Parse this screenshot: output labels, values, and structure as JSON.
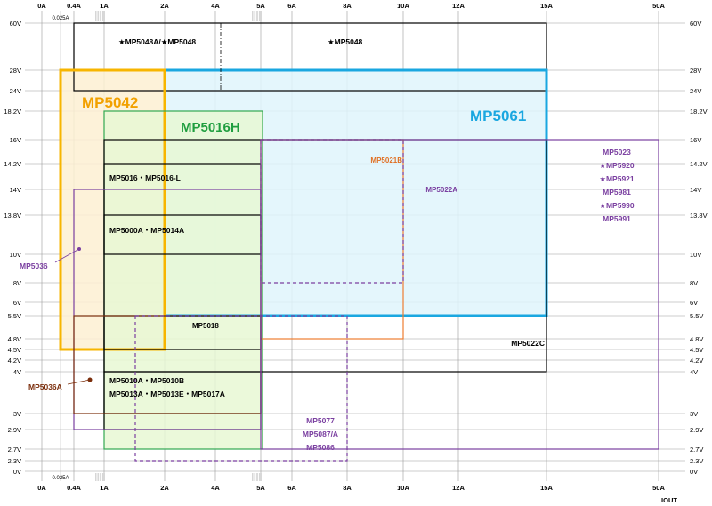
{
  "chart_data": {
    "type": "table",
    "x_axis": {
      "ticks": [
        {
          "label": "0A",
          "x": 0
        },
        {
          "label": "0.4A",
          "x": 0.4
        },
        {
          "label": "1A",
          "x": 1
        },
        {
          "label": "2A",
          "x": 2
        },
        {
          "label": "4A",
          "x": 4
        },
        {
          "label": "5A",
          "x": 5
        },
        {
          "label": "6A",
          "x": 6
        },
        {
          "label": "8A",
          "x": 8
        },
        {
          "label": "10A",
          "x": 10
        },
        {
          "label": "12A",
          "x": 12
        },
        {
          "label": "15A",
          "x": 15
        },
        {
          "label": "50A",
          "x": 50
        }
      ],
      "extra_tick": {
        "label": "0.025A",
        "x": 0.025
      },
      "unit_label": "IOUT"
    },
    "y_axis": {
      "ticks": [
        {
          "label": "0V",
          "y": 0
        },
        {
          "label": "2.3V",
          "y": 2.3
        },
        {
          "label": "2.7V",
          "y": 2.7
        },
        {
          "label": "2.9V",
          "y": 2.9
        },
        {
          "label": "3V",
          "y": 3
        },
        {
          "label": "4V",
          "y": 4
        },
        {
          "label": "4.2V",
          "y": 4.2
        },
        {
          "label": "4.5V",
          "y": 4.5
        },
        {
          "label": "4.8V",
          "y": 4.8
        },
        {
          "label": "5.5V",
          "y": 5.5
        },
        {
          "label": "6V",
          "y": 6
        },
        {
          "label": "8V",
          "y": 8
        },
        {
          "label": "10V",
          "y": 10
        },
        {
          "label": "13.8V",
          "y": 13.8
        },
        {
          "label": "14V",
          "y": 14
        },
        {
          "label": "14.2V",
          "y": 14.2
        },
        {
          "label": "16V",
          "y": 16
        },
        {
          "label": "18.2V",
          "y": 18.2
        },
        {
          "label": "24V",
          "y": 24
        },
        {
          "label": "28V",
          "y": 28
        },
        {
          "label": "60V",
          "y": 60
        }
      ]
    },
    "regions": [
      {
        "labels": [
          "★MP5048A/★MP5048",
          "★MP5048"
        ],
        "x": [
          0.4,
          15
        ],
        "y": [
          24,
          60
        ],
        "color": "#000000",
        "style": "solid"
      },
      {
        "labels": [
          "MP5061"
        ],
        "x": [
          2,
          15
        ],
        "y": [
          5.5,
          28
        ],
        "color": "#1aa7e0",
        "fill": "#dff4fb",
        "style": "thick"
      },
      {
        "labels": [
          "MP5042"
        ],
        "x": [
          0.025,
          2
        ],
        "y": [
          4.5,
          28
        ],
        "color": "#f7b500",
        "fill": "#fdf0d2",
        "style": "thick"
      },
      {
        "labels": [
          "MP5016H"
        ],
        "x": [
          1,
          5.5
        ],
        "y": [
          2.7,
          18.2
        ],
        "color": "#32a852",
        "fill": "#e8f8d4",
        "style": "solid"
      },
      {
        "labels": [
          "MP5021B"
        ],
        "x": [
          5,
          10
        ],
        "y": [
          4.8,
          16
        ],
        "color": "#ee7d31",
        "style": "solid"
      },
      {
        "labels": [
          "MP5022A"
        ],
        "x": [
          5,
          10
        ],
        "y": [
          8,
          16
        ],
        "color": "#7a3fa0",
        "style": "dashed"
      },
      {
        "labels": [
          "MP5022C"
        ],
        "x": [
          1,
          15
        ],
        "y": [
          4,
          16
        ],
        "color": "#000000",
        "style": "solid"
      },
      {
        "labels": [
          "MP5016・MP5016-L"
        ],
        "x": [
          1,
          5
        ],
        "y": [
          3,
          14.2
        ],
        "color": "#000000",
        "style": "solid"
      },
      {
        "labels": [
          "MP5000A・MP5014A"
        ],
        "x": [
          1,
          5
        ],
        "y": [
          10,
          13.8
        ],
        "color": "#000000",
        "style": "solid"
      },
      {
        "labels": [
          "MP5018"
        ],
        "x": [
          1,
          5
        ],
        "y": [
          4.5,
          5.5
        ],
        "color": "#000000",
        "style": "solid"
      },
      {
        "labels": [
          "MP5010A・MP5010B",
          "MP5013A・MP5013E・MP5017A"
        ],
        "x": [
          1,
          5
        ],
        "y": [
          2.9,
          4
        ],
        "color": "#000000",
        "style": "solid"
      },
      {
        "labels": [
          "MP5036"
        ],
        "x": [
          0.4,
          5
        ],
        "y": [
          2.9,
          14
        ],
        "color": "#7a3fa0",
        "style": "solid"
      },
      {
        "labels": [
          "MP5036A"
        ],
        "x": [
          0.4,
          5
        ],
        "y": [
          3,
          5.5
        ],
        "color": "#7b2e0c",
        "style": "solid"
      },
      {
        "labels": [
          "MP5077",
          "MP5087/A",
          "MP5086"
        ],
        "x": [
          1.4,
          8
        ],
        "y": [
          2.3,
          5.5
        ],
        "color": "#7a3fa0",
        "style": "dashed"
      },
      {
        "labels": [
          "MP5023",
          "★MP5920",
          "★MP5921",
          "MP5981",
          "★MP5990",
          "MP5991"
        ],
        "x": [
          5,
          50
        ],
        "y": [
          2.7,
          16
        ],
        "color": "#7a3fa0",
        "style": "solid"
      }
    ]
  }
}
